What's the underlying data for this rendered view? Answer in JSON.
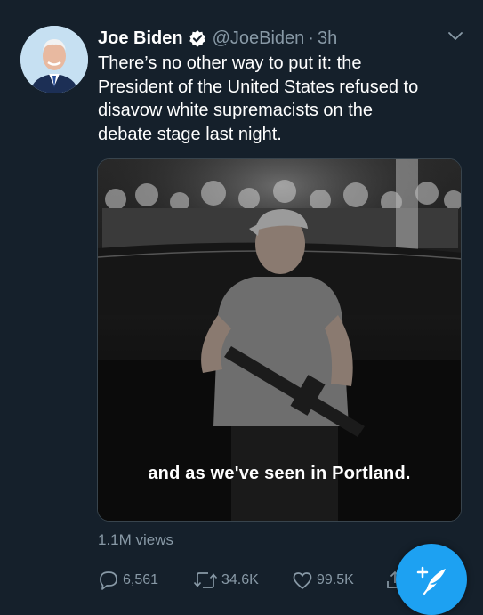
{
  "tweet": {
    "author": {
      "display_name": "Joe Biden",
      "handle": "@JoeBiden",
      "separator": "·",
      "time": "3h",
      "verified_icon": "verified-badge-icon"
    },
    "text_lines": [
      "There’s no other way to put it: the",
      "President of the United States refused to",
      "disavow white supremacists on the",
      "debate stage last night."
    ],
    "media": {
      "caption": "and as we've seen in Portland."
    },
    "views": "1.1M views",
    "actions": {
      "reply": {
        "icon": "reply-icon",
        "count": "6,561"
      },
      "retweet": {
        "icon": "retweet-icon",
        "count": "34.6K"
      },
      "like": {
        "icon": "like-icon",
        "count": "99.5K"
      },
      "share": {
        "icon": "share-icon"
      }
    }
  },
  "compose_button": {
    "icon": "compose-tweet-icon"
  },
  "colors": {
    "background": "#15202b",
    "secondary_text": "#8899a6",
    "accent": "#1da1f2"
  }
}
